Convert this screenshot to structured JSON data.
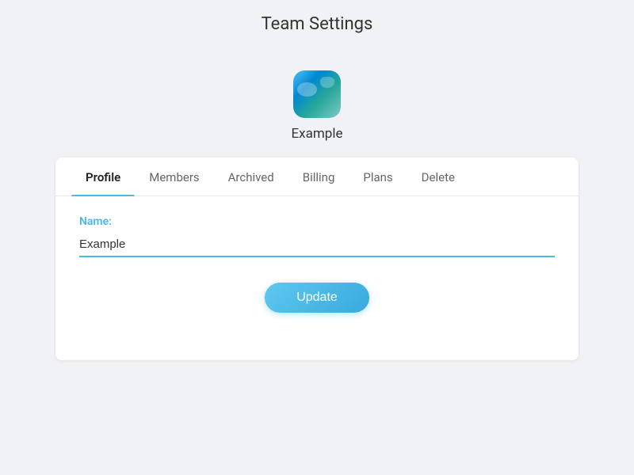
{
  "header": {
    "title": "Team Settings"
  },
  "team": {
    "name": "Example",
    "avatar_alt": "Team avatar - ocean scene"
  },
  "tabs": [
    {
      "id": "profile",
      "label": "Profile",
      "active": true
    },
    {
      "id": "members",
      "label": "Members",
      "active": false
    },
    {
      "id": "archived",
      "label": "Archived",
      "active": false
    },
    {
      "id": "billing",
      "label": "Billing",
      "active": false
    },
    {
      "id": "plans",
      "label": "Plans",
      "active": false
    },
    {
      "id": "delete",
      "label": "Delete",
      "active": false
    }
  ],
  "profile_form": {
    "name_label": "Name:",
    "name_value": "Example",
    "update_button_label": "Update"
  }
}
